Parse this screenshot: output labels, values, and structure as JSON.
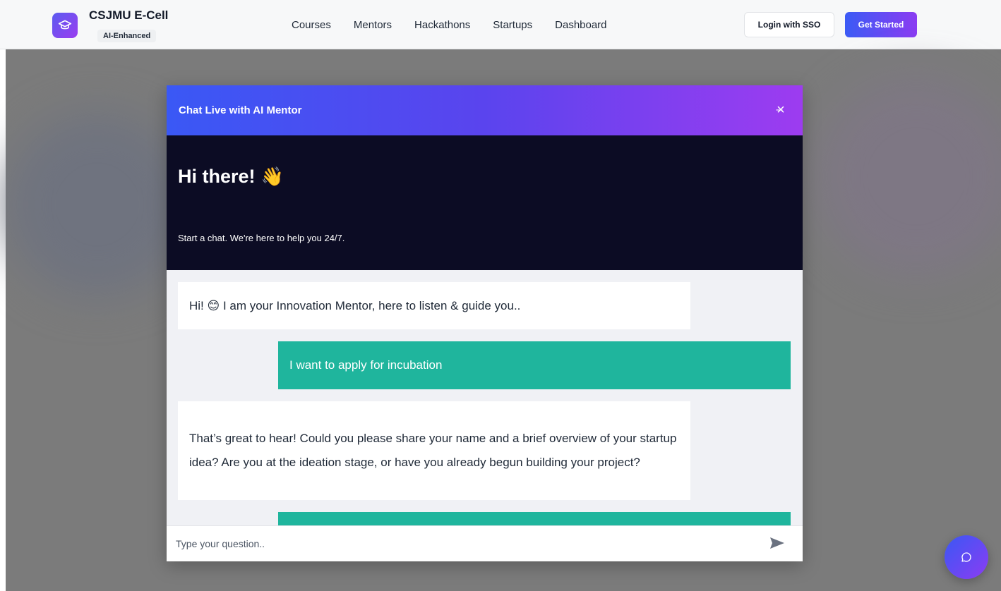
{
  "brand": {
    "title": "CSJMU E-Cell",
    "badge": "AI-Enhanced",
    "icon": "graduation-cap-icon"
  },
  "nav": {
    "links": [
      "Courses",
      "Mentors",
      "Hackathons",
      "Startups",
      "Dashboard"
    ]
  },
  "header_buttons": {
    "login": "Login with SSO",
    "get_started": "Get Started"
  },
  "chat": {
    "title": "Chat Live with AI Mentor",
    "minimize": "–",
    "close": "×",
    "hero_title": "Hi there!",
    "hero_emoji": "👋",
    "hero_subtitle": "Start a chat. We're here to help you 24/7.",
    "messages": [
      {
        "from": "bot",
        "text": "Hi! 😊 I am your Innovation Mentor, here to listen & guide you.."
      },
      {
        "from": "user",
        "text": "I want to apply for incubation"
      },
      {
        "from": "bot",
        "text": "That’s great to hear! Could you please share your name and a brief overview of your startup idea? Are you at the ideation stage, or have you already begun building your project?"
      },
      {
        "from": "user",
        "text": ""
      }
    ],
    "input_placeholder": "Type your question..",
    "send_icon": "send-icon"
  },
  "fab_icon": "chat-bubble-icon",
  "colors": {
    "accent_start": "#3a58f5",
    "accent_end": "#9d3cf0",
    "user_bubble": "#1fb59d",
    "hero_bg": "#0c0c24"
  }
}
